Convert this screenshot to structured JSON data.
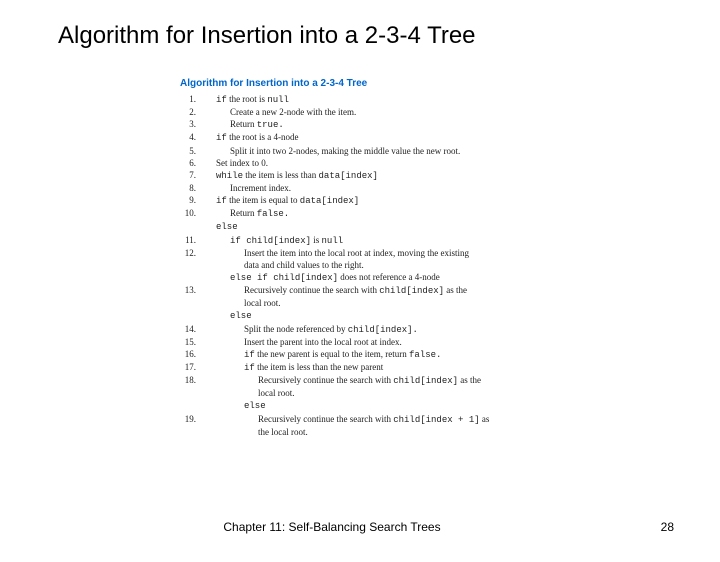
{
  "title": "Algorithm for Insertion into a 2-3-4 Tree",
  "algo_title": "Algorithm for Insertion into a 2-3-4 Tree",
  "lines": [
    {
      "n": "1.",
      "i": 1,
      "pre": "if",
      "code": " the root is ",
      "tail_code": "null"
    },
    {
      "n": "2.",
      "i": 2,
      "txt": "Create a new 2-node with the item."
    },
    {
      "n": "3.",
      "i": 2,
      "txt": "Return ",
      "tail_code": "true."
    },
    {
      "n": "4.",
      "i": 1,
      "pre": "if",
      "code": " the root is a 4-node"
    },
    {
      "n": "5.",
      "i": 2,
      "txt": "Split it into two 2-nodes, making the middle value the new root."
    },
    {
      "n": "6.",
      "i": 1,
      "txt": "Set index to 0."
    },
    {
      "n": "7.",
      "i": 1,
      "pre": "while",
      "code": " the item is less than ",
      "tail_code": "data[index]"
    },
    {
      "n": "8.",
      "i": 2,
      "txt": "Increment index."
    },
    {
      "n": "9.",
      "i": 1,
      "pre": "if",
      "code": " the item is equal to ",
      "tail_code": "data[index]"
    },
    {
      "n": "10.",
      "i": 2,
      "txt": "Return ",
      "tail_code": "false."
    },
    {
      "n": "",
      "i": 1,
      "pre": "else"
    },
    {
      "n": "11.",
      "i": 2,
      "pre": "if ",
      "mid_code": "child[index]",
      "post": " is ",
      "tail_code": "null"
    },
    {
      "n": "12.",
      "i": 3,
      "txt": "Insert the item into the local root at index, moving the existing"
    },
    {
      "n": "",
      "i": 3,
      "txt": "data and child values to the right."
    },
    {
      "n": "",
      "i": 2,
      "pre": "else if ",
      "mid_code": "child[index]",
      "post": " does not reference a 4-node"
    },
    {
      "n": "13.",
      "i": 3,
      "txt": "Recursively continue the search with ",
      "tail_code": "child[index]",
      "post2": " as the"
    },
    {
      "n": "",
      "i": 3,
      "txt": "local root."
    },
    {
      "n": "",
      "i": 2,
      "pre": "else"
    },
    {
      "n": "14.",
      "i": 3,
      "txt": "Split the node referenced by ",
      "tail_code": "child[index]."
    },
    {
      "n": "15.",
      "i": 3,
      "txt": "Insert the parent into the local root at index."
    },
    {
      "n": "16.",
      "i": 3,
      "pre": "if",
      "code": " the new parent is equal to the item, return ",
      "tail_code": "false."
    },
    {
      "n": "17.",
      "i": 3,
      "pre": "if",
      "code": " the item is less than the new parent"
    },
    {
      "n": "18.",
      "i": 4,
      "txt": "Recursively continue the search with ",
      "tail_code": "child[index]",
      "post2": " as the"
    },
    {
      "n": "",
      "i": 4,
      "txt": "local root."
    },
    {
      "n": "",
      "i": 3,
      "pre": "else"
    },
    {
      "n": "19.",
      "i": 4,
      "txt": "Recursively continue the search with ",
      "tail_code": "child[index + 1]",
      "post2": " as"
    },
    {
      "n": "",
      "i": 4,
      "txt": "the local root."
    }
  ],
  "footer_chapter": "Chapter 11: Self-Balancing Search Trees",
  "footer_page": "28"
}
